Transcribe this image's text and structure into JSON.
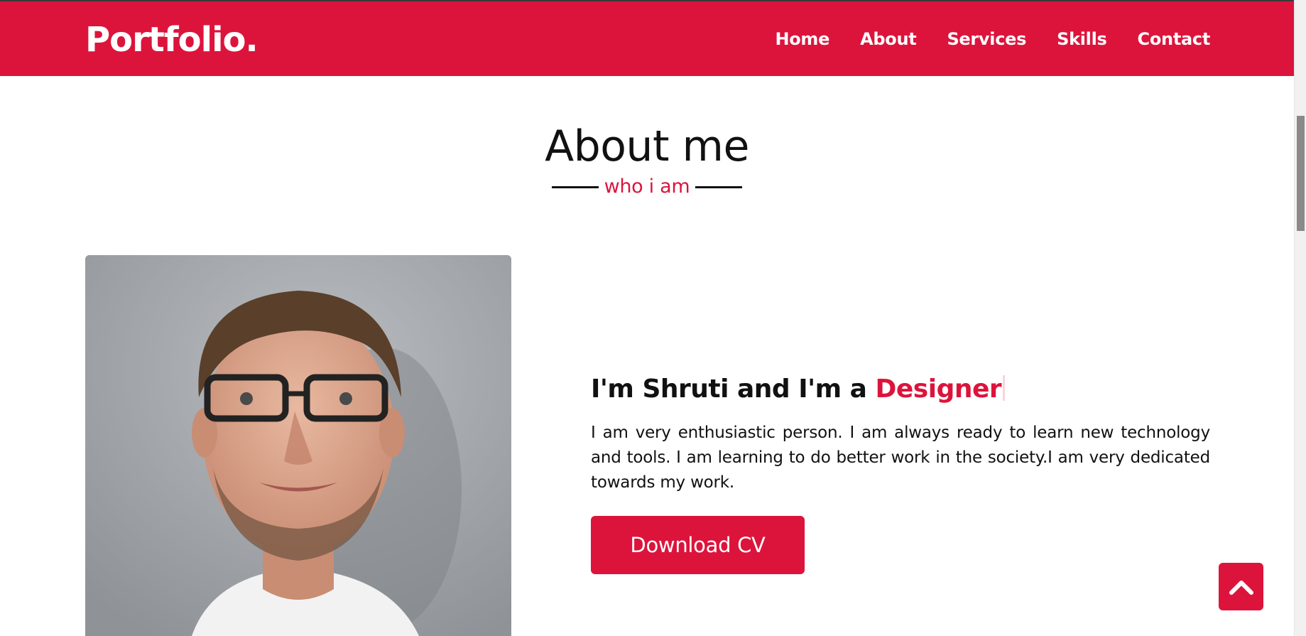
{
  "navbar": {
    "logo": "Portfolio.",
    "links": [
      "Home",
      "About",
      "Services",
      "Skills",
      "Contact"
    ]
  },
  "about": {
    "title": "About me",
    "subtitle": "who i am",
    "intro_prefix": "I'm Shruti and I'm a ",
    "intro_role": "Designer",
    "description": "I am very enthusiastic person. I am always ready to learn new technology and tools. I am learning to do better work in the society.I am very dedicated towards my work.",
    "cv_button": "Download CV"
  },
  "icons": {
    "scroll_top": "chevron-up-icon"
  },
  "colors": {
    "accent": "#dc143c",
    "text": "#111111",
    "background": "#ffffff"
  }
}
